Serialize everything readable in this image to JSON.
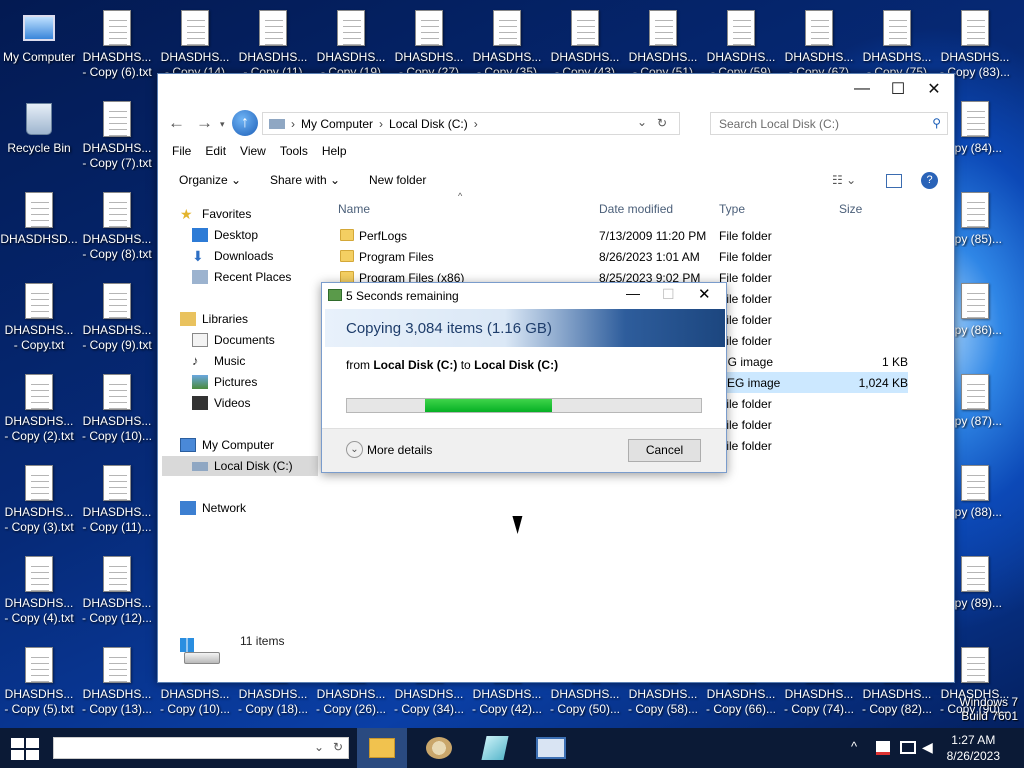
{
  "desktop": {
    "icons_col1": [
      {
        "l1": "My Computer",
        "l2": "",
        "icon": "computer-icon"
      },
      {
        "l1": "Recycle Bin",
        "l2": "",
        "icon": "recycle-bin-icon"
      },
      {
        "l1": "DHASDHSD...",
        "l2": "",
        "icon": "text-file-icon"
      },
      {
        "l1": "DHASDHS...",
        "l2": "- Copy.txt",
        "icon": "text-file-icon"
      },
      {
        "l1": "DHASDHS...",
        "l2": "- Copy (2).txt",
        "icon": "text-file-icon"
      },
      {
        "l1": "DHASDHS...",
        "l2": "- Copy (3).txt",
        "icon": "text-file-icon"
      },
      {
        "l1": "DHASDHS...",
        "l2": "- Copy (4).txt",
        "icon": "text-file-icon"
      },
      {
        "l1": "DHASDHS...",
        "l2": "- Copy (5).txt",
        "icon": "text-file-icon"
      }
    ],
    "icons_col2": [
      {
        "l1": "DHASDHS...",
        "l2": "- Copy (6).txt"
      },
      {
        "l1": "DHASDHS...",
        "l2": "- Copy (7).txt"
      },
      {
        "l1": "DHASDHS...",
        "l2": "- Copy (8).txt"
      },
      {
        "l1": "DHASDHS...",
        "l2": "- Copy (9).txt"
      },
      {
        "l1": "DHASDHS...",
        "l2": "- Copy (10)..."
      },
      {
        "l1": "DHASDHS...",
        "l2": "- Copy (11)..."
      },
      {
        "l1": "DHASDHS...",
        "l2": "- Copy (12)..."
      },
      {
        "l1": "DHASDHS...",
        "l2": "- Copy (13)..."
      }
    ],
    "icons_top": [
      {
        "l1": "DHASDHS...",
        "l2": "- Copy (14)"
      },
      {
        "l1": "DHASDHS...",
        "l2": "- Copy (11)"
      },
      {
        "l1": "DHASDHS...",
        "l2": "- Copy (19)"
      },
      {
        "l1": "DHASDHS...",
        "l2": "- Copy (27)"
      },
      {
        "l1": "DHASDHS...",
        "l2": "- Copy (35)"
      },
      {
        "l1": "DHASDHS...",
        "l2": "- Copy (43)"
      },
      {
        "l1": "DHASDHS...",
        "l2": "- Copy (51)"
      },
      {
        "l1": "DHASDHS...",
        "l2": "- Copy (59)"
      },
      {
        "l1": "DHASDHS...",
        "l2": "- Copy (67)"
      },
      {
        "l1": "DHASDHS...",
        "l2": "- Copy (75)"
      },
      {
        "l1": "DHASDHS...",
        "l2": "- Copy (83)..."
      }
    ],
    "icons_bottom": [
      {
        "l1": "DHASDHS...",
        "l2": "- Copy (10)..."
      },
      {
        "l1": "DHASDHS...",
        "l2": "- Copy (18)..."
      },
      {
        "l1": "DHASDHS...",
        "l2": "- Copy (26)..."
      },
      {
        "l1": "DHASDHS...",
        "l2": "- Copy (34)..."
      },
      {
        "l1": "DHASDHS...",
        "l2": "- Copy (42)..."
      },
      {
        "l1": "DHASDHS...",
        "l2": "- Copy (50)..."
      },
      {
        "l1": "DHASDHS...",
        "l2": "- Copy (58)..."
      },
      {
        "l1": "DHASDHS...",
        "l2": "- Copy (66)..."
      },
      {
        "l1": "DHASDHS...",
        "l2": "- Copy (74)..."
      },
      {
        "l1": "DHASDHS...",
        "l2": "- Copy (82)..."
      },
      {
        "l1": "DHASDHS...",
        "l2": "- Copy (90)..."
      }
    ],
    "icons_right": [
      {
        "l1": "",
        "l2": "opy (84)..."
      },
      {
        "l1": "",
        "l2": "opy (85)..."
      },
      {
        "l1": "",
        "l2": "opy (86)..."
      },
      {
        "l1": "",
        "l2": "opy (87)..."
      },
      {
        "l1": "",
        "l2": "opy (88)..."
      },
      {
        "l1": "",
        "l2": "opy (89)..."
      }
    ],
    "watermark_l1": "Windows 7",
    "watermark_l2": "Build 7601"
  },
  "explorer": {
    "breadcrumb": [
      "My Computer",
      "Local Disk (C:)"
    ],
    "search_placeholder": "Search Local Disk (C:)",
    "menu": [
      "File",
      "Edit",
      "View",
      "Tools",
      "Help"
    ],
    "toolbar": {
      "organize": "Organize",
      "share_with": "Share with",
      "new_folder": "New folder"
    },
    "sidebar": {
      "favorites": "Favorites",
      "favorites_items": [
        "Desktop",
        "Downloads",
        "Recent Places"
      ],
      "libraries": "Libraries",
      "libraries_items": [
        "Documents",
        "Music",
        "Pictures",
        "Videos"
      ],
      "computer": "My Computer",
      "computer_items": [
        "Local Disk (C:)"
      ],
      "network": "Network"
    },
    "columns": {
      "name": "Name",
      "date": "Date modified",
      "type": "Type",
      "size": "Size"
    },
    "rows": [
      {
        "name": "PerfLogs",
        "date": "7/13/2009 11:20 PM",
        "type": "File folder",
        "size": ""
      },
      {
        "name": "Program Files",
        "date": "8/26/2023 1:01 AM",
        "type": "File folder",
        "size": ""
      },
      {
        "name": "Program Files (x86)",
        "date": "8/25/2023 9:02 PM",
        "type": "File folder",
        "size": ""
      },
      {
        "name": "",
        "date": "",
        "type": "File folder",
        "size": ""
      },
      {
        "name": "",
        "date": "",
        "type": "File folder",
        "size": ""
      },
      {
        "name": "",
        "date": "",
        "type": "File folder",
        "size": ""
      },
      {
        "name": "",
        "date": "",
        "type": "NG image",
        "size": "1 KB"
      },
      {
        "name": "",
        "date": "",
        "type": "PEG image",
        "size": "1,024 KB"
      },
      {
        "name": "",
        "date": "",
        "type": "File folder",
        "size": ""
      },
      {
        "name": "",
        "date": "",
        "type": "File folder",
        "size": ""
      },
      {
        "name": "",
        "date": "",
        "type": "File folder",
        "size": ""
      }
    ],
    "status_count": "11 items"
  },
  "copy_dialog": {
    "title": "5 Seconds remaining",
    "heading": "Copying 3,084 items (1.16 GB)",
    "from_label": "from",
    "from": "Local Disk (C:)",
    "to_label": "to",
    "to": "Local Disk (C:)",
    "progress_start": 0.22,
    "progress_end": 0.58,
    "more_details": "More details",
    "cancel": "Cancel"
  },
  "taskbar": {
    "time": "1:27 AM",
    "date": "8/26/2023"
  },
  "colors": {
    "progress": "#06b025",
    "selection": "#cce8ff"
  }
}
